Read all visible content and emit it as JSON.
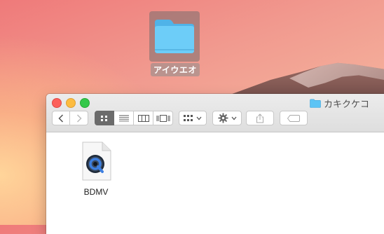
{
  "desktop": {
    "folder_label": "アイウエオ"
  },
  "window": {
    "title": "カキクケコ",
    "files": [
      {
        "name": "BDMV"
      }
    ]
  },
  "colors": {
    "folder_blue": "#5cc4f5",
    "close": "#fc605b",
    "minimize": "#fdbc40",
    "maximize": "#34c84a",
    "active_view": "#6b6b6b"
  }
}
